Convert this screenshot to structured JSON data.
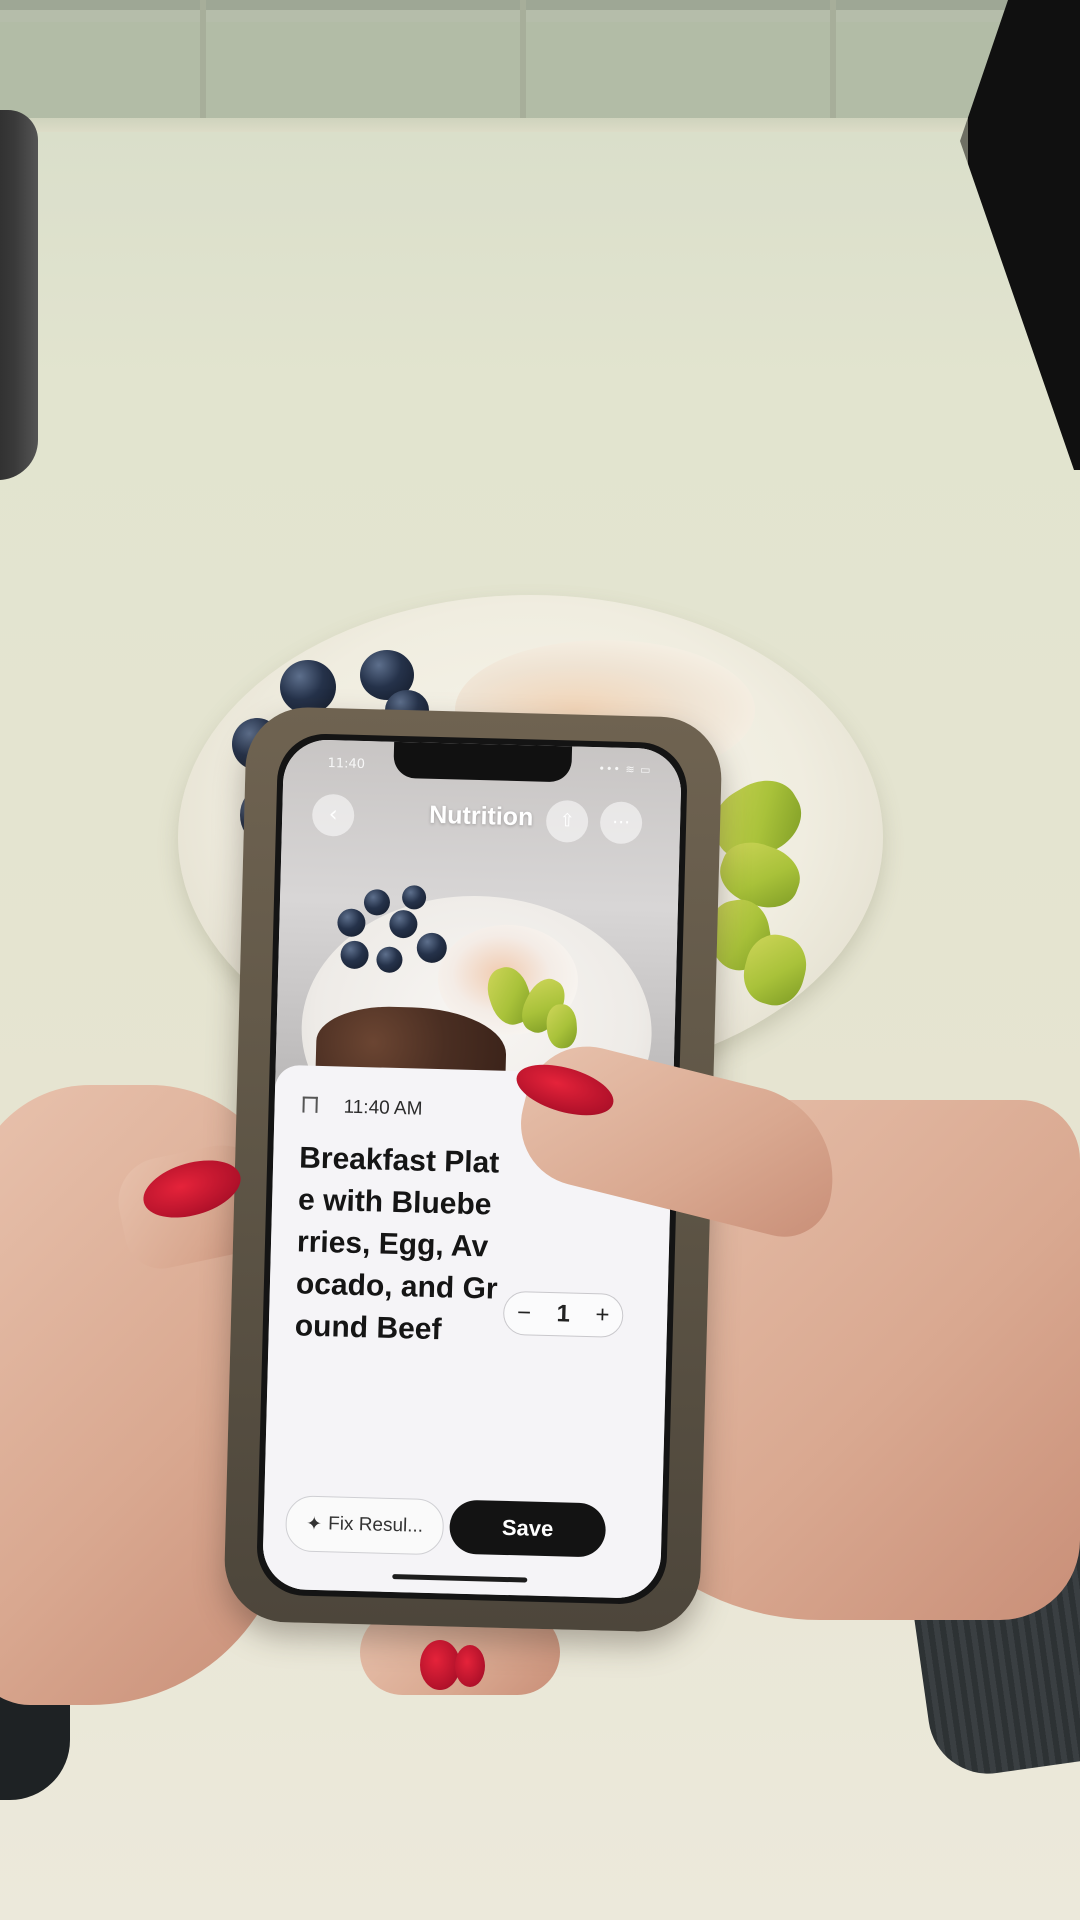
{
  "status_bar": {
    "time": "11:40",
    "icons": "••• ≋ ▭"
  },
  "nav": {
    "title": "Nutrition",
    "back_icon": "back-icon",
    "share_icon": "share-icon",
    "more_icon": "more-icon"
  },
  "entry": {
    "bookmark_icon": "bookmark-icon",
    "time": "11:40 AM",
    "title": "Breakfast Plate with Blueberries, Egg, Avocado, and Ground Beef",
    "quantity": "1",
    "decrement_label": "−",
    "increment_label": "+"
  },
  "actions": {
    "fix_icon": "✦",
    "fix_label": "Fix Resul...",
    "save_label": "Save"
  },
  "colors": {
    "accent": "#131313",
    "sheet_bg": "#f5f4f7",
    "nail_polish": "#c8172f"
  }
}
